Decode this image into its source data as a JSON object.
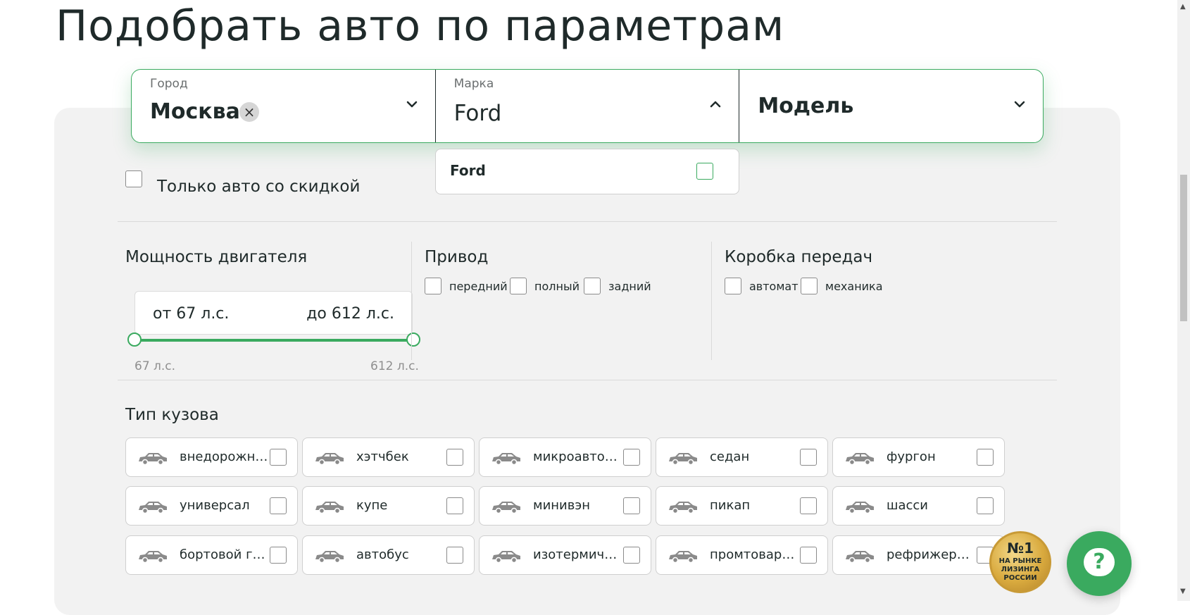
{
  "page": {
    "title": "Подобрать авто по параметрам"
  },
  "selectors": {
    "city": {
      "label": "Город",
      "value": "Москва",
      "clear": "×"
    },
    "brand": {
      "label": "Марка",
      "value": "Ford"
    },
    "model": {
      "value": "Модель"
    }
  },
  "brand_dropdown": {
    "options": [
      {
        "label": "Ford",
        "checked": false
      }
    ]
  },
  "discount": {
    "label": "Только авто со скидкой",
    "checked": false
  },
  "power": {
    "title": "Мощность двигателя",
    "from_text": "от 67 л.с.",
    "to_text": "до 612 л.с.",
    "min_label": "67 л.с.",
    "max_label": "612 л.с.",
    "min": 67,
    "max": 612,
    "selected_min": 67,
    "selected_max": 612
  },
  "drive": {
    "title": "Привод",
    "options": [
      "передний",
      "полный",
      "задний"
    ]
  },
  "gearbox": {
    "title": "Коробка передач",
    "options": [
      "автомат",
      "механика"
    ]
  },
  "body": {
    "title": "Тип кузова",
    "types": [
      {
        "label": "внедорожник",
        "icon": "suv-icon"
      },
      {
        "label": "хэтчбек",
        "icon": "hatchback-icon"
      },
      {
        "label": "микроавтобус",
        "icon": "minibus-icon"
      },
      {
        "label": "седан",
        "icon": "sedan-icon"
      },
      {
        "label": "фургон",
        "icon": "van-icon"
      },
      {
        "label": "универсал",
        "icon": "wagon-icon"
      },
      {
        "label": "купе",
        "icon": "coupe-icon"
      },
      {
        "label": "минивэн",
        "icon": "minivan-icon"
      },
      {
        "label": "пикап",
        "icon": "pickup-icon"
      },
      {
        "label": "шасси",
        "icon": "chassis-icon"
      },
      {
        "label": "бортовой гру...",
        "icon": "flatbed-truck-icon"
      },
      {
        "label": "автобус",
        "icon": "bus-icon"
      },
      {
        "label": "изотермическ...",
        "icon": "isothermal-truck-icon"
      },
      {
        "label": "промтоварны...",
        "icon": "cargo-truck-icon"
      },
      {
        "label": "рефрижератор",
        "icon": "refrigerator-truck-icon"
      }
    ]
  },
  "badge": {
    "top": "№1",
    "bottom": "НА РЫНКЕ ЛИЗИНГА РОССИИ"
  },
  "help": {
    "label": "?"
  },
  "colors": {
    "accent": "#3aaa5f",
    "panel": "#f2f2f2",
    "text": "#1f2a2a",
    "muted": "#8f8f8f"
  }
}
